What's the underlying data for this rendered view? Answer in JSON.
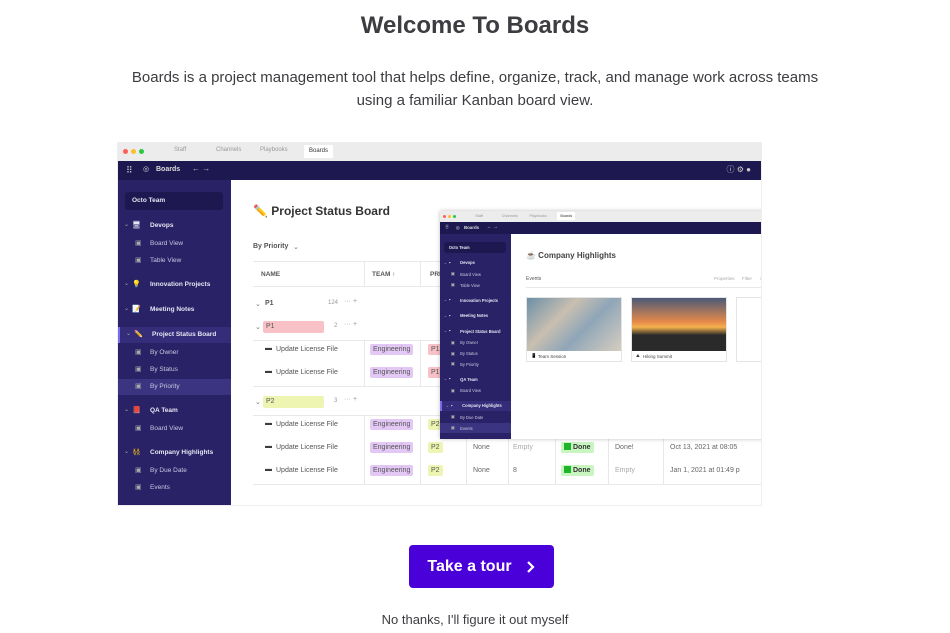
{
  "title": "Welcome To Boards",
  "description": "Boards is a project management tool that helps define, organize, track, and manage work across teams using a familiar Kanban board view.",
  "illustration": {
    "back": {
      "workspace": "Staff",
      "tabs": [
        "Channels",
        "Playbooks",
        "Boards"
      ],
      "app_name": "Boards",
      "team": "Octo Team",
      "sidebar": [
        {
          "label": "Devops",
          "icon": "🖥",
          "group": true
        },
        {
          "label": "Board View"
        },
        {
          "label": "Table View"
        },
        {
          "label": "Innovation Projects",
          "icon": "💡",
          "group": true
        },
        {
          "label": "Meeting Notes",
          "icon": "📝",
          "group": true
        },
        {
          "label": "Project Status Board",
          "icon": "✏️",
          "group": true,
          "selected": true
        },
        {
          "label": "By Owner"
        },
        {
          "label": "By Status"
        },
        {
          "label": "By Priority",
          "active": true
        },
        {
          "label": "QA Team",
          "icon": "📕",
          "group": true
        },
        {
          "label": "Board View"
        },
        {
          "label": "Company Highlights",
          "icon": "👯",
          "group": true
        },
        {
          "label": "By Due Date"
        },
        {
          "label": "Events"
        }
      ],
      "board_title": "✏️ Project Status Board",
      "view": "By Priority",
      "columns": [
        "NAME",
        "TEAM ↑",
        "PRI"
      ],
      "group_header": {
        "label": "P1",
        "count": "124"
      },
      "groups": [
        {
          "label": "P1",
          "count": "2",
          "rows": [
            {
              "name": "Update License File",
              "team": "Engineering",
              "pri": "P1"
            },
            {
              "name": "Update License File",
              "team": "Engineering",
              "pri": "P1"
            }
          ]
        },
        {
          "label": "P2",
          "count": "3",
          "rows": [
            {
              "name": "Update License File",
              "team": "Engineering",
              "pri": "P2"
            },
            {
              "name": "Update License File",
              "team": "Engineering",
              "pri": "P2",
              "c1": "None",
              "c2": "Empty",
              "status": "Done",
              "c4": "Done!",
              "date": "Oct 13, 2021 at 08:05"
            },
            {
              "name": "Update License File",
              "team": "Engineering",
              "pri": "P2",
              "c1": "None",
              "c2": "8",
              "status": "Done",
              "c4": "Empty",
              "date": "Jan 1, 2021 at 01:49 p"
            }
          ]
        }
      ]
    },
    "front": {
      "workspace": "Staff",
      "tabs": [
        "Channels",
        "Playbooks",
        "Boards"
      ],
      "app_name": "Boards",
      "team": "Octo Team",
      "sidebar": [
        {
          "label": "Devops",
          "group": true
        },
        {
          "label": "Board View"
        },
        {
          "label": "Table View"
        },
        {
          "label": "Innovation Projects",
          "group": true
        },
        {
          "label": "Meeting Notes",
          "group": true
        },
        {
          "label": "Project Status Board",
          "group": true
        },
        {
          "label": "By Owner"
        },
        {
          "label": "By Status"
        },
        {
          "label": "By Priority"
        },
        {
          "label": "QA Team",
          "group": true
        },
        {
          "label": "Board View"
        },
        {
          "label": "Company Highlights",
          "group": true,
          "selected": true
        },
        {
          "label": "By Due Date"
        },
        {
          "label": "Events",
          "active": true
        }
      ],
      "board_title": "☕ Company Highlights",
      "view": "Events",
      "toolbar": [
        "Properties",
        "Filter",
        "Sort",
        "Search",
        "···"
      ],
      "new_button": "New ▾",
      "cards": [
        {
          "title": "Team Session",
          "icon": "📱"
        },
        {
          "title": "Hiking Summit",
          "icon": "⛰"
        }
      ],
      "add_card": "+ New"
    }
  },
  "tour_button": "Take a tour",
  "skip_link": "No thanks, I'll figure it out myself",
  "colors": {
    "primary": "#4a00d9",
    "sidebar": "#2a2266",
    "nav": "#1e1850"
  }
}
